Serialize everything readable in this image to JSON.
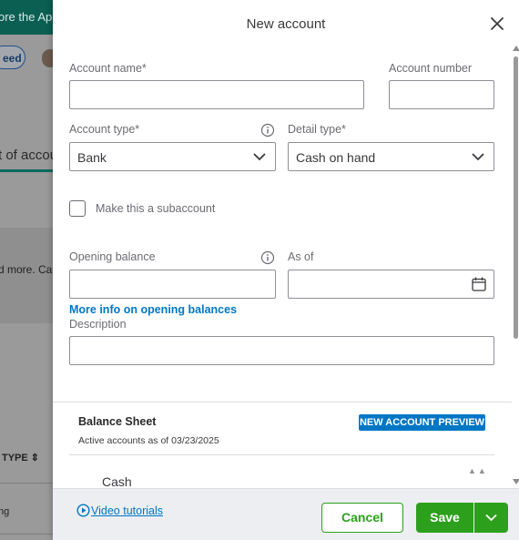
{
  "background": {
    "banner_text": "ore the Ap",
    "pill_text": "eed",
    "heading": "t of accou",
    "panel_text": "d more. Ca",
    "type_column": "TYPE",
    "row_text": "ng"
  },
  "drawer": {
    "title": "New account",
    "account_name_label": "Account name*",
    "account_name_value": "",
    "account_number_label": "Account number",
    "account_number_value": "",
    "account_type_label": "Account type*",
    "account_type_value": "Bank",
    "detail_type_label": "Detail type*",
    "detail_type_value": "Cash on hand",
    "subaccount_label": "Make this a subaccount",
    "subaccount_checked": false,
    "opening_balance_label": "Opening balance",
    "opening_balance_value": "",
    "as_of_label": "As of",
    "as_of_value": "",
    "opening_balance_link": "More info on opening balances",
    "description_label": "Description",
    "description_value": ""
  },
  "preview": {
    "title": "Balance Sheet",
    "badge": "NEW ACCOUNT PREVIEW",
    "subtitle": "Active accounts as of 03/23/2025",
    "first_row": "Cash"
  },
  "footer": {
    "video_link": "Video tutorials",
    "cancel_label": "Cancel",
    "save_label": "Save"
  },
  "colors": {
    "accent_green": "#2ca01c",
    "link_blue": "#0077c5",
    "brand_teal": "#0b5e52"
  }
}
